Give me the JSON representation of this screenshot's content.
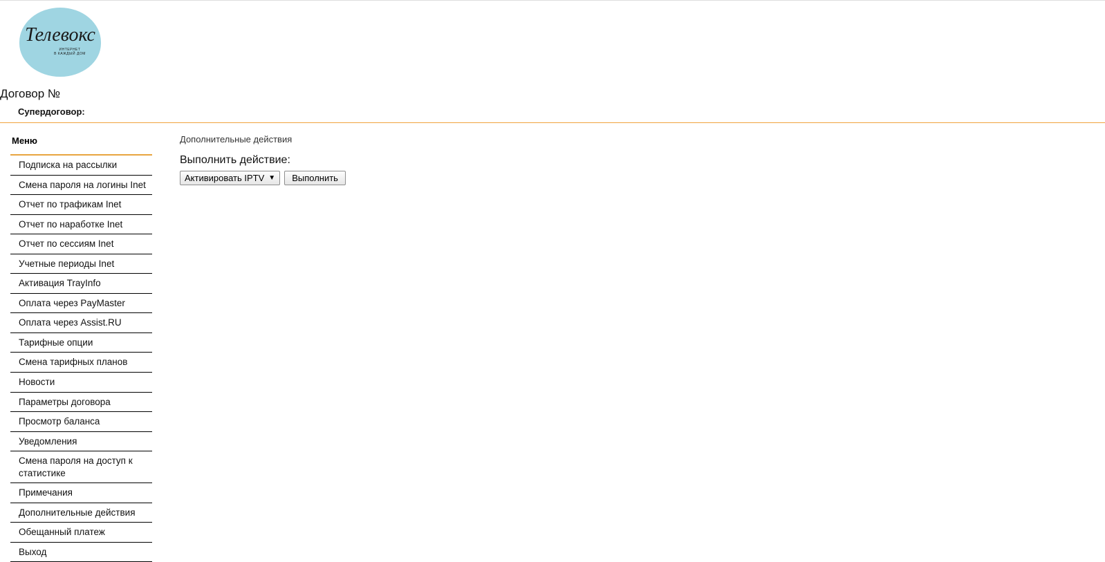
{
  "logo": {
    "script": "Телевокс",
    "sub1": "ИНТЕРНЕТ",
    "sub2": "В КАЖДЫЙ ДОМ"
  },
  "contract_label": "Договор №",
  "supercontract_label": "Супердоговор:",
  "menu_title": "Меню",
  "menu_items": [
    "Подписка на рассылки",
    "Смена пароля на логины Inet",
    "Отчет по трафикам Inet",
    "Отчет по наработке Inet",
    "Отчет по сессиям Inet",
    "Учетные периоды Inet",
    "Активация TrayInfo",
    "Оплата через PayMaster",
    "Оплата через Assist.RU",
    "Тарифные опции",
    "Смена тарифных планов",
    "Новости",
    "Параметры договора",
    "Просмотр баланса",
    "Уведомления",
    "Смена пароля на доступ к статистике",
    "Примечания",
    "Дополнительные действия",
    "Обещанный платеж",
    "Выход"
  ],
  "content": {
    "breadcrumb": "Дополнительные действия",
    "action_title": "Выполнить действие:",
    "select_value": "Активировать IPTV",
    "submit_label": "Выполнить"
  }
}
